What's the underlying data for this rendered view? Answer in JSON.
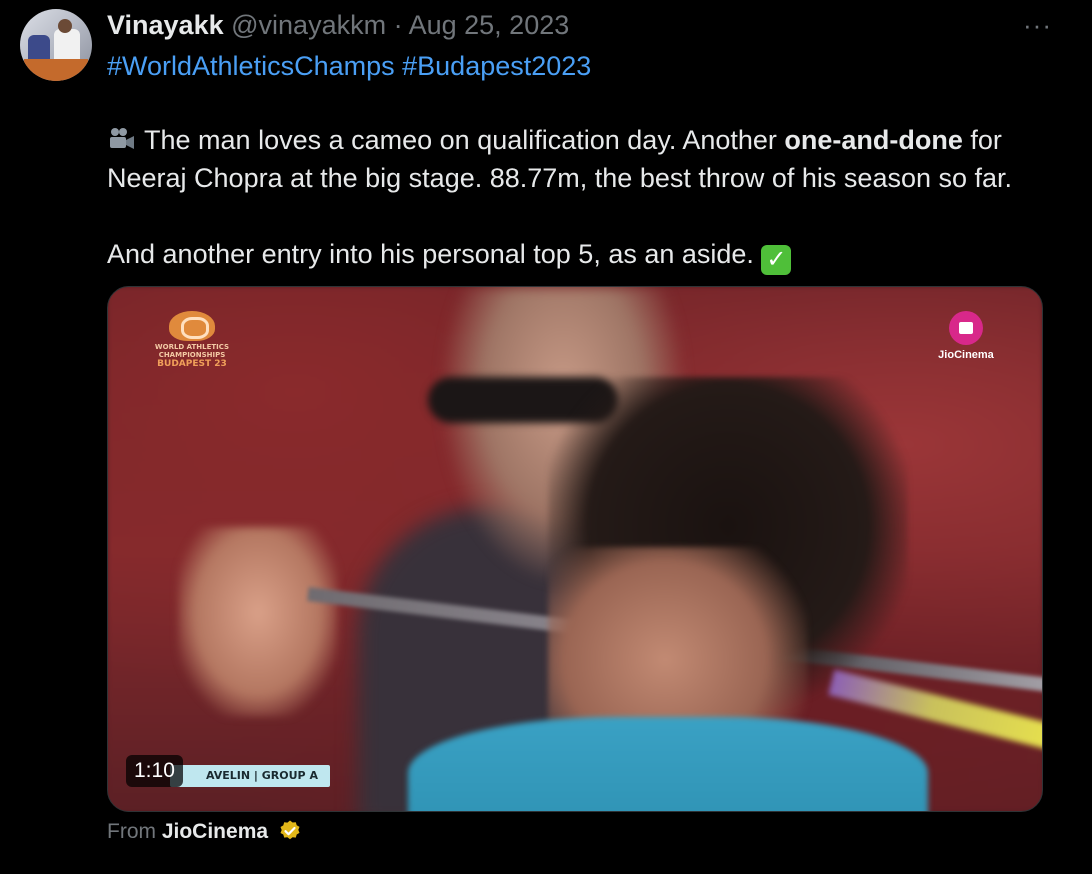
{
  "author": {
    "name": "Vinayakk",
    "handle": "@vinayakkm",
    "separator": "·",
    "date": "Aug 25, 2023"
  },
  "more_menu": "···",
  "hashtags": {
    "tag1": "#WorldAthleticsChamps",
    "tag2": "#Budapest2023"
  },
  "body": {
    "line1_pre": " The man loves a cameo on qualification day. Another ",
    "line1_bold": "one-and-done",
    "line1_post": " for Neeraj Chopra at the big stage. 88.77m, the best throw of his season so far.",
    "line2": "And another entry into his personal top 5, as an aside. ",
    "check_emoji": "✓"
  },
  "media": {
    "event_logo": {
      "line1": "WORLD ATHLETICS",
      "line2": "CHAMPIONSHIPS",
      "line3": "BUDAPEST 23"
    },
    "broadcaster": "JioCinema",
    "lower_third": "AVELIN | GROUP A",
    "duration": "1:10"
  },
  "source": {
    "prefix": "From",
    "name": "JioCinema",
    "verified_color": "#e2b719"
  },
  "colors": {
    "background": "#000000",
    "text": "#e7e9ea",
    "muted": "#71767b",
    "link": "#4a9ff5"
  }
}
